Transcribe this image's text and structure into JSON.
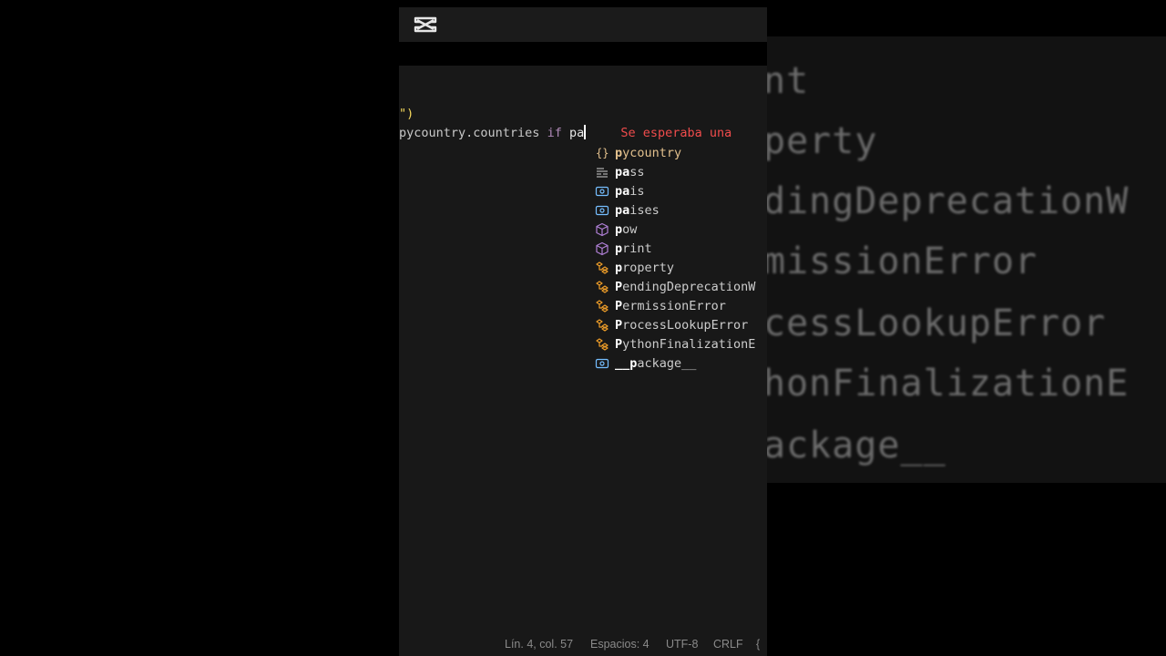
{
  "background_zoom": {
    "lines": [
      "nt",
      "perty",
      "dingDeprecationW",
      "missionError",
      "cessLookupError",
      "honFinalizationE",
      "ackage__"
    ]
  },
  "editor": {
    "line1": {
      "text": "\")"
    },
    "line2": {
      "part1": "pycountry.countries",
      "kw": "if",
      "typed": "pa",
      "error": "Se esperaba una"
    }
  },
  "suggest": {
    "items": [
      {
        "icon": "module-icon",
        "match": "p",
        "rest": "ycountry"
      },
      {
        "icon": "keyword-icon",
        "match": "pa",
        "rest": "ss"
      },
      {
        "icon": "variable-icon",
        "match": "pa",
        "rest": "is"
      },
      {
        "icon": "variable-icon",
        "match": "pa",
        "rest": "ises"
      },
      {
        "icon": "method-icon",
        "match": "p",
        "rest": "ow"
      },
      {
        "icon": "method-icon",
        "match": "p",
        "rest": "rint"
      },
      {
        "icon": "class-icon",
        "match": "p",
        "rest": "roperty"
      },
      {
        "icon": "class-icon",
        "match": "P",
        "rest": "endingDeprecationW"
      },
      {
        "icon": "class-icon",
        "match": "P",
        "rest": "ermissionError"
      },
      {
        "icon": "class-icon",
        "match": "P",
        "rest": "rocessLookupError"
      },
      {
        "icon": "class-icon",
        "match": "P",
        "rest": "ythonFinalizationE"
      },
      {
        "icon": "variable-icon",
        "match": "__p",
        "rest": "ackage__"
      }
    ]
  },
  "statusbar": {
    "position": "Lín. 4, col. 57",
    "spaces": "Espacios: 4",
    "encoding": "UTF-8",
    "eol": "CRLF",
    "lang_icon": "{"
  },
  "colors": {
    "module": "#e2c08d",
    "keyword": "#cccccc",
    "variable": "#75beff",
    "method": "#b180d7",
    "class": "#ee9d28",
    "error": "#f14c4c"
  }
}
